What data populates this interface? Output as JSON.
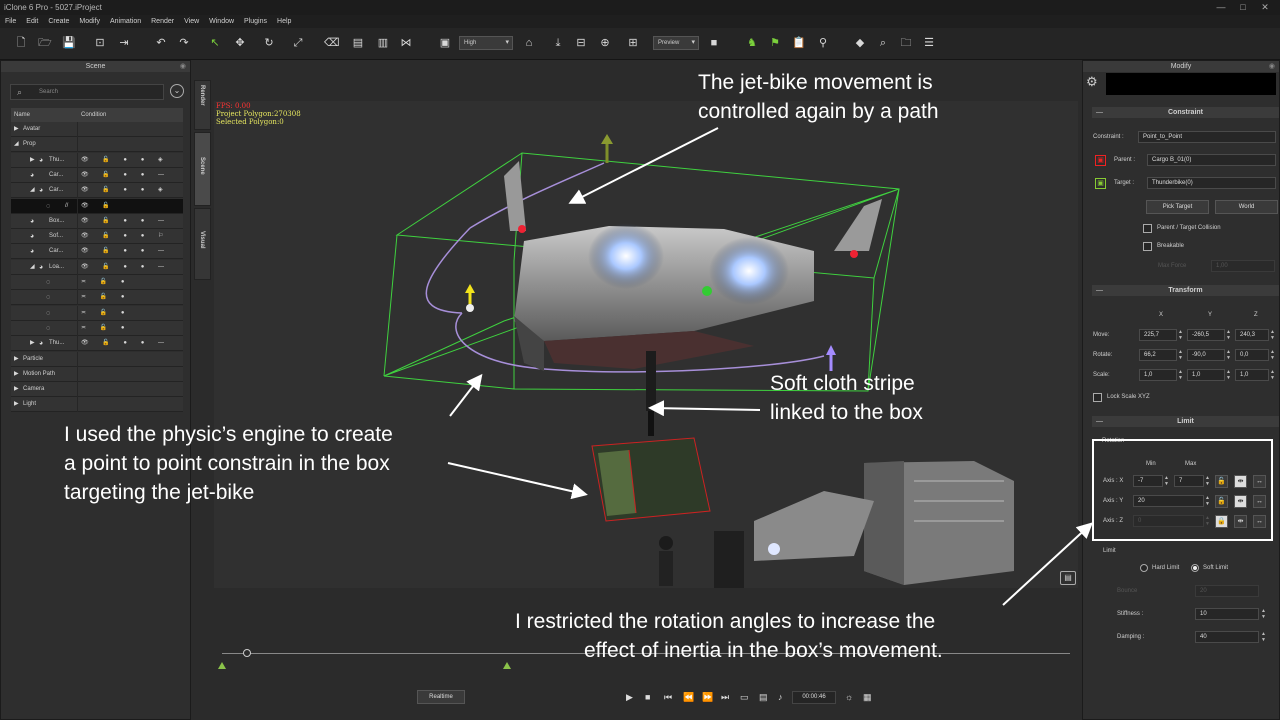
{
  "window": {
    "title": "iClone 6 Pro - 5027.iProject",
    "minimize": "—",
    "maximize": "□",
    "close": "✕"
  },
  "menu": [
    "File",
    "Edit",
    "Create",
    "Modify",
    "Animation",
    "Render",
    "View",
    "Window",
    "Plugins",
    "Help"
  ],
  "toolbar": {
    "quality": "High",
    "preview": "Preview"
  },
  "scene": {
    "title": "Scene",
    "search_placeholder": "Search",
    "col_name": "Name",
    "col_condition": "Condition",
    "rows": [
      {
        "name": "Avatar",
        "level": 0,
        "arrow": "▶"
      },
      {
        "name": "Prop",
        "level": 0,
        "arrow": "◢"
      },
      {
        "name": "Thu...",
        "level": 2,
        "arrow": "▶",
        "icons": "👁 🔓 ● ● ◈"
      },
      {
        "name": "Car...",
        "level": 2,
        "arrow": "",
        "icons": "👁 🔓 ● ● —"
      },
      {
        "name": "Car...",
        "level": 2,
        "arrow": "◢",
        "icons": "👁 🔓 ● ● ◈"
      },
      {
        "name": "//",
        "level": 4,
        "arrow": "",
        "icons": "👁 🔓"
      },
      {
        "name": "Box...",
        "level": 2,
        "arrow": "",
        "icons": "👁 🔓 ● ● —"
      },
      {
        "name": "Sof...",
        "level": 2,
        "arrow": "",
        "icons": "👁 🔓 ● ● ⚐"
      },
      {
        "name": "Car...",
        "level": 2,
        "arrow": "",
        "icons": "👁 🔓 ● ● —"
      },
      {
        "name": "Loa...",
        "level": 2,
        "arrow": "◢",
        "icons": "👁 🔓 ● ● —"
      },
      {
        "name": "",
        "level": 4,
        "arrow": "",
        "icons": "≍ 🔓 ●"
      },
      {
        "name": "",
        "level": 4,
        "arrow": "",
        "icons": "≍ 🔓 ●"
      },
      {
        "name": "",
        "level": 4,
        "arrow": "",
        "icons": "≍ 🔓 ●"
      },
      {
        "name": "",
        "level": 4,
        "arrow": "",
        "icons": "≍ 🔓 ●"
      },
      {
        "name": "Thu...",
        "level": 2,
        "arrow": "▶",
        "icons": "👁 🔓 ● ● —"
      },
      {
        "name": "Particle",
        "level": 0,
        "arrow": "▶"
      },
      {
        "name": "Motion Path",
        "level": 0,
        "arrow": "▶"
      },
      {
        "name": "Camera",
        "level": 0,
        "arrow": "▶"
      },
      {
        "name": "Light",
        "level": 0,
        "arrow": "▶"
      }
    ]
  },
  "side_tabs": [
    "Render",
    "Scene",
    "Visual"
  ],
  "viewport": {
    "fps": "FPS: 0.00",
    "polygons": "Project Polygon:270308",
    "selected": "Selected Polygon:0"
  },
  "playback": {
    "realtime": "Realtime",
    "time": "00:00:46"
  },
  "modify": {
    "title": "Modify",
    "constraint_header": "Constraint",
    "constraint_label": "Constraint :",
    "constraint_value": "Point_to_Point",
    "parent_label": "Parent :",
    "parent_value": "Cargo B_01(0)",
    "target_label": "Target :",
    "target_value": "Thunderbike(0)",
    "pick_target": "Pick Target",
    "world": "World",
    "collision": "Parent / Target Collision",
    "breakable": "Breakable",
    "max_force_label": "Max Force",
    "max_force_value": "1,00",
    "transform_header": "Transform",
    "col_x": "X",
    "col_y": "Y",
    "col_z": "Z",
    "move_label": "Move:",
    "move": [
      "225,7",
      "-260,5",
      "240,3"
    ],
    "rotate_label": "Rotate:",
    "rotate": [
      "66,2",
      "-90,0",
      "0,0"
    ],
    "scale_label": "Scale:",
    "scale": [
      "1,0",
      "1,0",
      "1,0"
    ],
    "lock_scale": "Lock Scale XYZ",
    "limit_header": "Limit",
    "rotation_label": "Rotation",
    "min_label": "Min",
    "max_label": "Max",
    "axis_x_label": "Axis : X",
    "axis_x_min": "-7",
    "axis_x_max": "7",
    "axis_y_label": "Axis : Y",
    "axis_y_min": "20",
    "axis_z_label": "Axis : Z",
    "axis_z_min": "0",
    "limit_label": "Limit",
    "hard_limit": "Hard Limit",
    "soft_limit": "Soft Limit",
    "bounce_label": "Bounce",
    "bounce_value": "20",
    "stiffness_label": "Stiffness :",
    "stiffness_value": "10",
    "damping_label": "Damping :",
    "damping_value": "40"
  },
  "annotations": {
    "path_line1": "The jet-bike movement is",
    "path_line2": "controlled again by a path",
    "cloth_line1": "Soft cloth stripe",
    "cloth_line2": "linked to the box",
    "physics_line1": "I used the physic’s engine to create",
    "physics_line2": "a point to point constrain in the box",
    "physics_line3": "targeting the jet-bike",
    "limit_line1": "I restricted the rotation angles to increase the",
    "limit_line2": "effect of inertia in the box’s movement."
  }
}
